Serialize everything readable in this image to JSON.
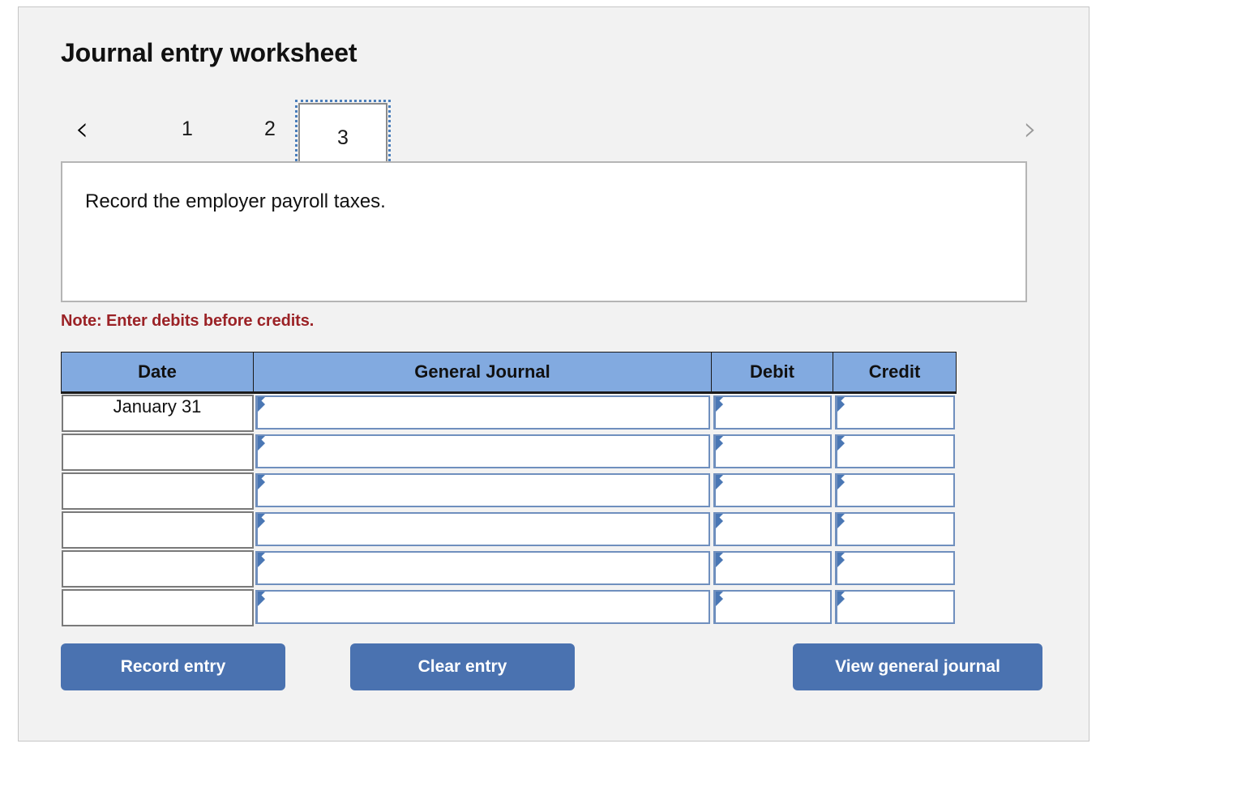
{
  "page": {
    "title": "Journal entry worksheet"
  },
  "nav": {
    "prev_icon": "chevron-left-icon",
    "next_icon": "chevron-right-icon",
    "prev_glyph": "‹",
    "next_glyph": "›",
    "tabs": [
      {
        "label": "1",
        "selected": false
      },
      {
        "label": "2",
        "selected": false
      },
      {
        "label": "3",
        "selected": true
      }
    ]
  },
  "description": {
    "text": "Record the employer payroll taxes."
  },
  "note": {
    "text": "Note: Enter debits before credits."
  },
  "table": {
    "headers": {
      "date": "Date",
      "general_journal": "General Journal",
      "debit": "Debit",
      "credit": "Credit"
    },
    "rows": [
      {
        "date": "January 31",
        "general_journal": "",
        "debit": "",
        "credit": ""
      },
      {
        "date": "",
        "general_journal": "",
        "debit": "",
        "credit": ""
      },
      {
        "date": "",
        "general_journal": "",
        "debit": "",
        "credit": ""
      },
      {
        "date": "",
        "general_journal": "",
        "debit": "",
        "credit": ""
      },
      {
        "date": "",
        "general_journal": "",
        "debit": "",
        "credit": ""
      },
      {
        "date": "",
        "general_journal": "",
        "debit": "",
        "credit": ""
      }
    ]
  },
  "buttons": {
    "record": "Record entry",
    "clear": "Clear entry",
    "view": "View general journal"
  },
  "colors": {
    "panel_background": "#f2f2f2",
    "header_blue": "#82aae0",
    "button_blue": "#4a72b0",
    "note_red": "#9b2226",
    "cell_border_blue": "#6f8fbe",
    "marker_blue": "#4a77b4"
  }
}
